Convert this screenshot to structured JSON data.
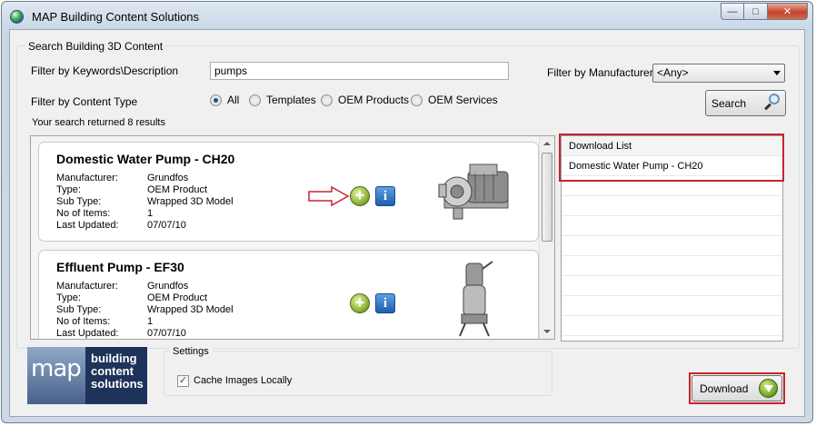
{
  "window": {
    "title": "MAP Building Content Solutions",
    "controls": [
      "minimize",
      "maximize",
      "close"
    ]
  },
  "search_group": {
    "legend": "Search Building 3D Content",
    "keywords_label": "Filter by Keywords\\Description",
    "keywords_value": "pumps",
    "manufacturer_label": "Filter by Manufacturer",
    "manufacturer_value": "<Any>",
    "content_type_label": "Filter by Content Type",
    "content_types": [
      {
        "label": "All",
        "checked": true
      },
      {
        "label": "Templates",
        "checked": false
      },
      {
        "label": "OEM Products",
        "checked": false
      },
      {
        "label": "OEM Services",
        "checked": false
      }
    ],
    "search_button": "Search",
    "results_summary": "Your search returned 8 results"
  },
  "results": [
    {
      "title": "Domestic Water Pump - CH20",
      "manufacturer": "Grundfos",
      "type": "OEM Product",
      "sub_type": "Wrapped 3D Model",
      "no_of_items": "1",
      "last_updated": "07/07/10"
    },
    {
      "title": "Effluent Pump - EF30",
      "manufacturer": "Grundfos",
      "type": "OEM Product",
      "sub_type": "Wrapped 3D Model",
      "no_of_items": "1",
      "last_updated": "07/07/10"
    }
  ],
  "field_labels": {
    "manufacturer": "Manufacturer:",
    "type": "Type:",
    "sub_type": "Sub Type:",
    "no_of_items": "No of Items:",
    "last_updated": "Last Updated:"
  },
  "download_list": {
    "header": "Download List",
    "items": [
      "Domestic Water Pump - CH20"
    ]
  },
  "logo": {
    "mark": "map",
    "line1": "building",
    "line2": "content",
    "line3": "solutions"
  },
  "settings": {
    "legend": "Settings",
    "cache_images_label": "Cache Images Locally",
    "cache_images_checked": true
  },
  "download_button": "Download",
  "colors": {
    "highlight": "#c8232c",
    "logo_bg": "#1e3359"
  }
}
